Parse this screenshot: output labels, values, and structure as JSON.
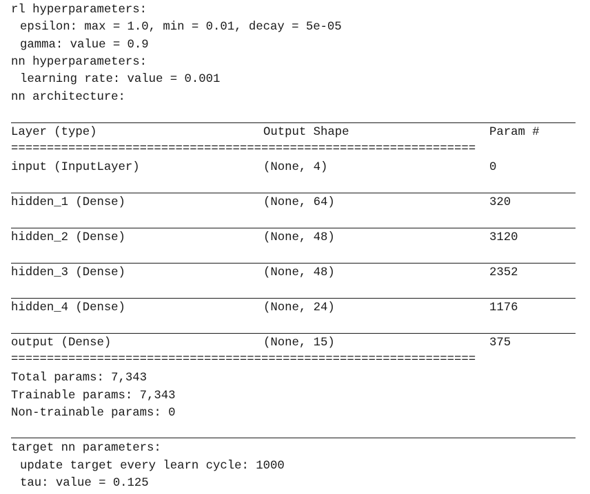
{
  "rl": {
    "heading": "rl hyperparameters:",
    "epsilon": "epsilon: max = 1.0, min = 0.01, decay = 5e-05",
    "gamma": "gamma: value = 0.9"
  },
  "nn": {
    "heading": "nn hyperparameters:",
    "learning_rate": "learning rate: value = 0.001",
    "arch_heading": "nn architecture:"
  },
  "summary": {
    "headers": {
      "layer": "Layer (type)",
      "shape": "Output Shape",
      "param": "Param #"
    },
    "separator": "=================================================================",
    "rows": [
      {
        "layer": "input (InputLayer)",
        "shape": "(None, 4)",
        "param": "0"
      },
      {
        "layer": "hidden_1 (Dense)",
        "shape": "(None, 64)",
        "param": "320"
      },
      {
        "layer": "hidden_2 (Dense)",
        "shape": "(None, 48)",
        "param": "3120"
      },
      {
        "layer": "hidden_3 (Dense)",
        "shape": "(None, 48)",
        "param": "2352"
      },
      {
        "layer": "hidden_4 (Dense)",
        "shape": "(None, 24)",
        "param": "1176"
      },
      {
        "layer": "output (Dense)",
        "shape": "(None, 15)",
        "param": "375"
      }
    ],
    "total": "Total params: 7,343",
    "trainable": "Trainable params: 7,343",
    "non_trainable": "Non-trainable params: 0"
  },
  "target": {
    "heading": "target nn parameters:",
    "update": "update target every learn cycle: 1000",
    "tau": "tau: value = 0.125"
  }
}
